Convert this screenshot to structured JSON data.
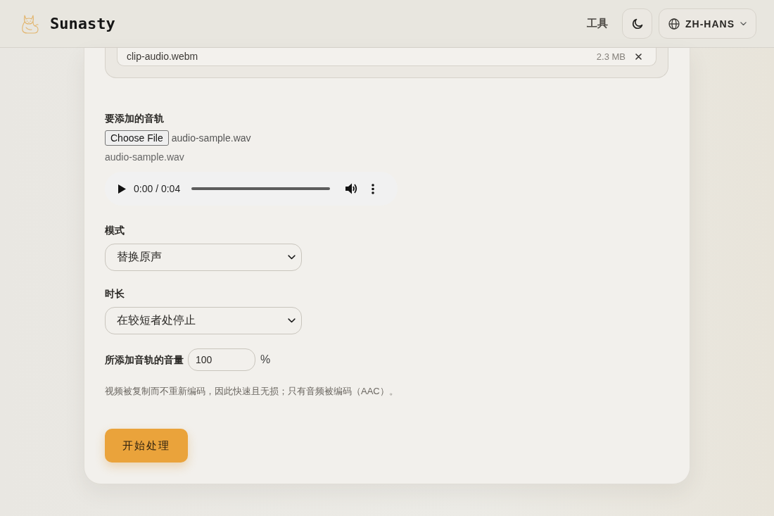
{
  "header": {
    "brand": "Sunasty",
    "nav_link": "工具",
    "language": "ZH-HANS"
  },
  "files": [
    {
      "name": "clip-audio.webm",
      "size": "2.3 MB"
    }
  ],
  "audio_track": {
    "label": "要添加的音轨",
    "button": "Choose File",
    "chosen_file": "audio-sample.wav",
    "file_name": "audio-sample.wav",
    "player": {
      "time": "0:00 / 0:04"
    }
  },
  "fields": [
    {
      "kind": "select",
      "label": "模式",
      "value": "替换原声"
    },
    {
      "kind": "select",
      "label": "时长",
      "value": "在较短者处停止"
    },
    {
      "kind": "number",
      "label": "所添加音轨的音量",
      "value": "100",
      "unit": "%"
    }
  ],
  "note": "视频被复制而不重新编码，因此快速且无损；只有音频被编码（AAC）。",
  "submit": "开始处理"
}
